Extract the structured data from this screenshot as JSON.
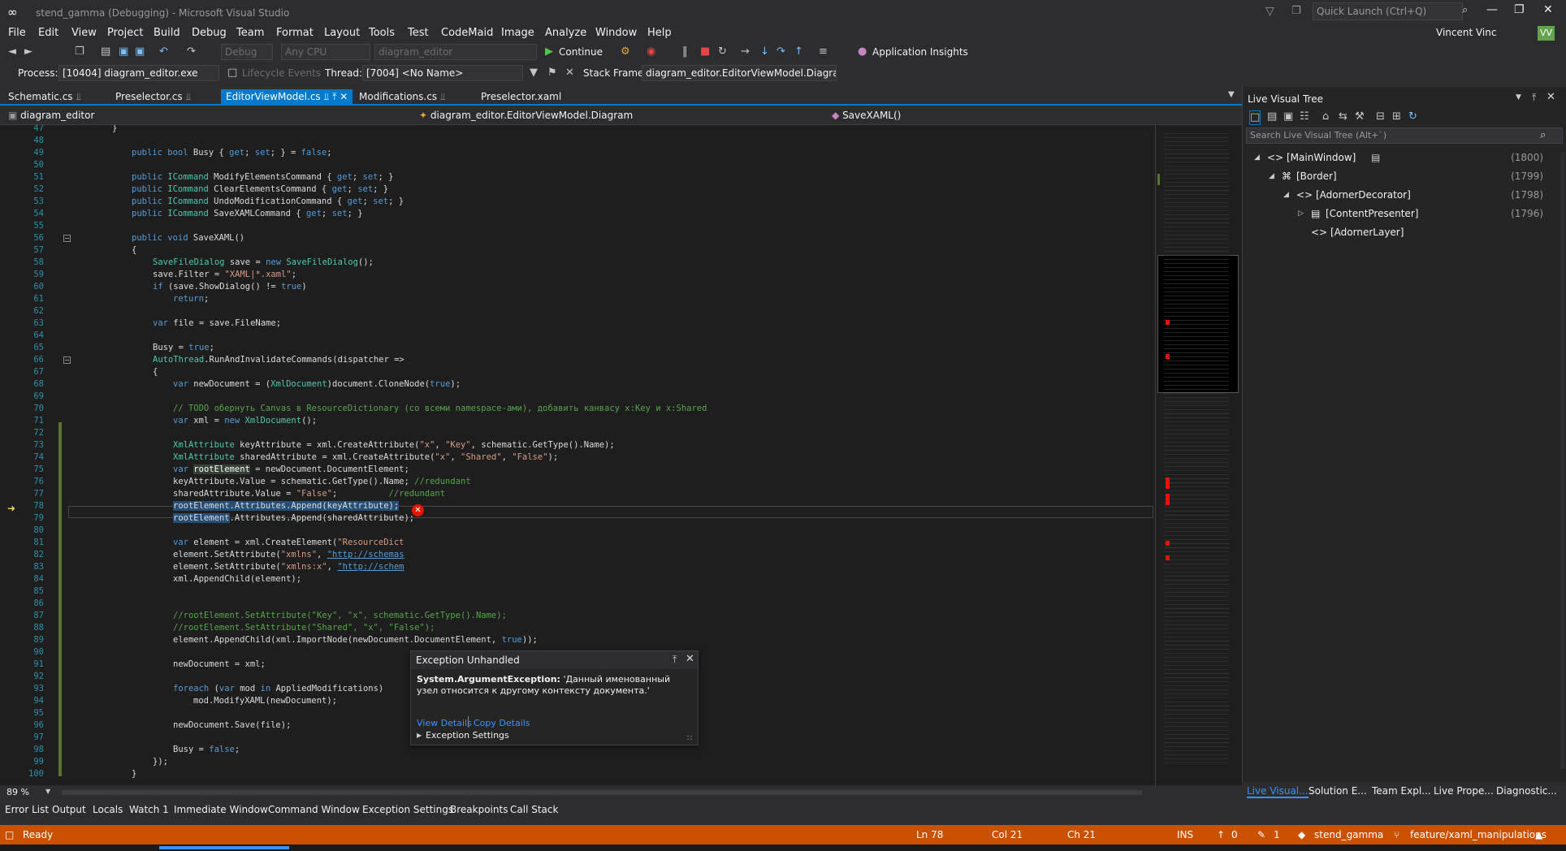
{
  "title": "stend_gamma (Debugging) - Microsoft Visual Studio",
  "quick_launch": "Quick Launch (Ctrl+Q)",
  "user": "Vincent Vinc",
  "user_initials": "VV",
  "menu": [
    "File",
    "Edit",
    "View",
    "Project",
    "Build",
    "Debug",
    "Team",
    "Format",
    "Layout",
    "Tools",
    "Test",
    "CodeMaid",
    "Image",
    "Analyze",
    "Window",
    "Help"
  ],
  "toolbar": {
    "config": "Debug",
    "platform": "Any CPU",
    "project": "diagram_editor",
    "continue": "Continue",
    "app_insights": "Application Insights"
  },
  "debugbar": {
    "process_label": "Process:",
    "process": "[10404] diagram_editor.exe",
    "lifecycle": "Lifecycle Events",
    "thread_label": "Thread:",
    "thread": "[7004] <No Name>",
    "stackframe_label": "Stack Frame:",
    "stackframe": "diagram_editor.EditorViewModel.Diagram"
  },
  "tabs": [
    "Schematic.cs",
    "Preselector.cs",
    "EditorViewModel.cs",
    "Modifications.cs",
    "Preselector.xaml"
  ],
  "nav": {
    "project": "diagram_editor",
    "type": "diagram_editor.EditorViewModel.Diagram",
    "member": "SaveXAML()"
  },
  "line_numbers": [
    "47",
    "48",
    "49",
    "50",
    "51",
    "52",
    "53",
    "54",
    "55",
    "56",
    "57",
    "58",
    "59",
    "60",
    "61",
    "62",
    "63",
    "64",
    "65",
    "66",
    "67",
    "68",
    "69",
    "70",
    "71",
    "72",
    "73",
    "74",
    "75",
    "76",
    "77",
    "78",
    "79",
    "80",
    "81",
    "82",
    "83",
    "84",
    "85",
    "86",
    "87",
    "88",
    "89",
    "90",
    "91",
    "92",
    "93",
    "94",
    "95",
    "96",
    "97",
    "98",
    "99",
    "100"
  ],
  "zoom": "89 %",
  "exception": {
    "header": "Exception Unhandled",
    "type": "System.ArgumentException:",
    "message": "'Данный именованный узел относится к другому контексту документа.'",
    "view_details": "View Details",
    "copy_details": "Copy Details",
    "settings": "Exception Settings"
  },
  "live_tree": {
    "title": "Live Visual Tree",
    "search": "Search Live Visual Tree (Alt+`)",
    "nodes": [
      {
        "label": "[MainWindow]",
        "count": "(1800)"
      },
      {
        "label": "[Border]",
        "count": "(1799)"
      },
      {
        "label": "[AdornerDecorator]",
        "count": "(1798)"
      },
      {
        "label": "[ContentPresenter]",
        "count": "(1796)"
      },
      {
        "label": "[AdornerLayer]",
        "count": ""
      }
    ]
  },
  "right_tabs": [
    "Live Visual...",
    "Solution E...",
    "Team Expl...",
    "Live Prope...",
    "Diagnostic..."
  ],
  "bottom_tabs": [
    "Error List",
    "Output",
    "Locals",
    "Watch 1",
    "Immediate Window",
    "Command Window",
    "Exception Settings",
    "Breakpoints",
    "Call Stack"
  ],
  "status": {
    "ready": "Ready",
    "ln": "Ln 78",
    "col": "Col 21",
    "ch": "Ch 21",
    "ins": "INS",
    "up": "0",
    "pencil": "1",
    "repo": "stend_gamma",
    "branch": "feature/xaml_manipulations"
  }
}
